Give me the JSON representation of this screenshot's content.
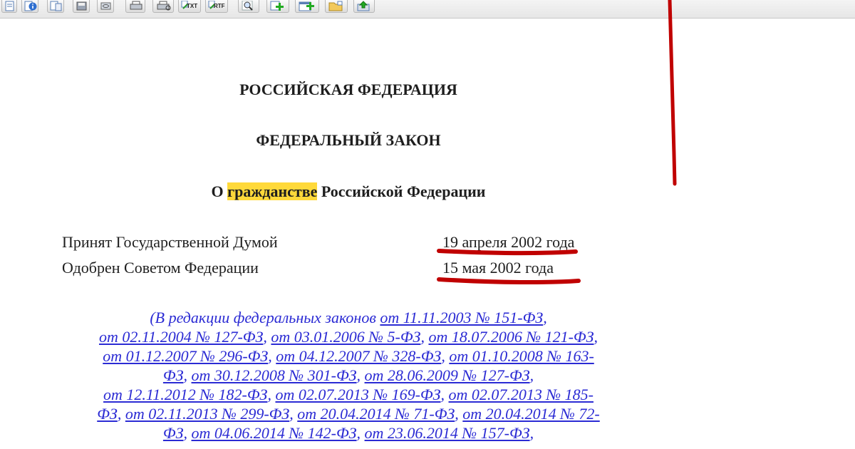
{
  "toolbar": {
    "buttons": [
      {
        "icon": "document-icon"
      },
      {
        "icon": "info-icon"
      },
      {
        "icon": "document-list-icon"
      },
      {
        "icon": "save-icon"
      },
      {
        "icon": "link-icon"
      },
      {
        "icon": "print-icon"
      },
      {
        "icon": "print-preview-icon"
      },
      {
        "icon": "export-txt-icon",
        "text": "TXT"
      },
      {
        "icon": "export-rtf-icon",
        "text": "RTF"
      },
      {
        "icon": "search-icon"
      },
      {
        "icon": "add-document-icon"
      },
      {
        "icon": "add-to-list-icon"
      },
      {
        "icon": "folder-icon"
      },
      {
        "icon": "export-icon"
      }
    ]
  },
  "document": {
    "country": "РОССИЙСКАЯ ФЕДЕРАЦИЯ",
    "doc_type": "ФЕДЕРАЛЬНЫЙ ЗАКОН",
    "title_prefix": "О",
    "title_highlight": "гражданстве",
    "title_suffix": "Российской Федерации",
    "adopted_label": "Принят Государственной Думой",
    "adopted_date": "19 апреля 2002 года",
    "approved_label": "Одобрен Советом Федерации",
    "approved_date": "15 мая 2002 года",
    "redaction_intro": "(В редакции федеральных законов ",
    "redaction_lines": [
      [
        "от 11.11.2003 № 151-ФЗ"
      ],
      [
        "от 02.11.2004 № 127-ФЗ",
        "от 03.01.2006 № 5-ФЗ",
        "от 18.07.2006 № 121-ФЗ"
      ],
      [
        "от 01.12.2007 № 296-ФЗ",
        "от 04.12.2007 № 328-ФЗ",
        "от 01.10.2008 № 163-"
      ],
      [
        "ФЗ",
        "от 30.12.2008 № 301-ФЗ",
        "от 28.06.2009 № 127-ФЗ"
      ],
      [
        "от 12.11.2012 № 182-ФЗ",
        "от 02.07.2013 № 169-ФЗ",
        "от 02.07.2013 № 185-"
      ],
      [
        "ФЗ",
        "от 02.11.2013 № 299-ФЗ",
        "от 20.04.2014 № 71-ФЗ",
        "от 20.04.2014 № 72-"
      ],
      [
        "ФЗ",
        "от 04.06.2014 № 142-ФЗ",
        "от 23.06.2014 № 157-ФЗ"
      ]
    ]
  },
  "colors": {
    "link": "#2b2bd4",
    "highlight": "#ffd93a",
    "annotation": "#c00000"
  }
}
